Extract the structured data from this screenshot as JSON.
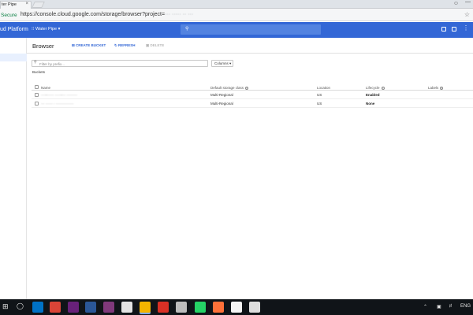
{
  "browser": {
    "tab_title": "ter Pipe",
    "tab_close": "×",
    "secure_label": "Secure",
    "url_prefix": "https://console.cloud.google.com/storage/browser?project=",
    "url_project": "··· ····· ·· ···"
  },
  "gcp": {
    "title": "ud Platform",
    "project": "Water Pipe",
    "icons": [
      "console-icon",
      "notifications-icon",
      "more-icon"
    ]
  },
  "toolbar": {
    "title": "Browser",
    "create_bucket": "CREATE BUCKET",
    "refresh": "REFRESH",
    "delete": "DELETE"
  },
  "filter": {
    "placeholder": "Filter by prefix...",
    "columns_label": "Columns"
  },
  "buckets_label": "Buckets",
  "table": {
    "headers": {
      "name": "Name",
      "storage_class": "Default storage class",
      "location": "Location",
      "lifecycle": "Lifecycle",
      "labels": "Labels"
    },
    "rows": [
      {
        "name": "····-······ ·····-··· ·········",
        "storage_class": "Multi-Regional",
        "location": "US",
        "lifecycle": "Enabled"
      },
      {
        "name": "··· ······ · ···············",
        "storage_class": "Multi-Regional",
        "location": "US",
        "lifecycle": "None"
      }
    ]
  },
  "taskbar": {
    "lang": "ENG",
    "apps": [
      {
        "name": "outlook-icon",
        "color": "#0072c6"
      },
      {
        "name": "chrome-icon",
        "color": "#db4437"
      },
      {
        "name": "visual-studio-icon",
        "color": "#68217a"
      },
      {
        "name": "app-icon",
        "color": "#2b5797"
      },
      {
        "name": "onenote-icon",
        "color": "#80397b"
      },
      {
        "name": "app2-icon",
        "color": "#e3e3e3"
      },
      {
        "name": "chrome-active-icon",
        "color": "#f4b400"
      },
      {
        "name": "pdf-icon",
        "color": "#d93025"
      },
      {
        "name": "app3-icon",
        "color": "#bdbdbd"
      },
      {
        "name": "whatsapp-icon",
        "color": "#25d366"
      },
      {
        "name": "firefox-icon",
        "color": "#ff7139"
      },
      {
        "name": "video-icon",
        "color": "#f5f5f5"
      },
      {
        "name": "photos-icon",
        "color": "#dedede"
      }
    ]
  }
}
